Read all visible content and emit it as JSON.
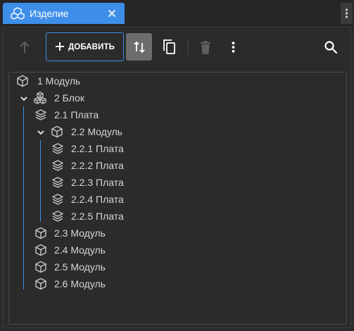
{
  "tab": {
    "title": "Изделие",
    "icon": "cubes-outline-icon"
  },
  "toolbar": {
    "add_label": "ДОБАВИТЬ"
  },
  "tree": [
    {
      "label": "1 Модуль",
      "icon": "cube-icon"
    },
    {
      "label": "2 Блок",
      "icon": "block-stack-icon",
      "expanded": true
    },
    {
      "label": "2.1 Плата",
      "icon": "layers-icon"
    },
    {
      "label": "2.2 Модуль",
      "icon": "cube-icon",
      "expanded": true
    },
    {
      "label": "2.2.1 Плата",
      "icon": "layers-icon"
    },
    {
      "label": "2.2.2 Плата",
      "icon": "layers-icon"
    },
    {
      "label": "2.2.3 Плата",
      "icon": "layers-icon"
    },
    {
      "label": "2.2.4 Плата",
      "icon": "layers-icon"
    },
    {
      "label": "2.2.5 Плата",
      "icon": "layers-icon"
    },
    {
      "label": "2.3 Модуль",
      "icon": "cube-icon"
    },
    {
      "label": "2.4 Модуль",
      "icon": "cube-icon"
    },
    {
      "label": "2.5 Модуль",
      "icon": "cube-icon"
    },
    {
      "label": "2.6 Модуль",
      "icon": "cube-icon"
    }
  ],
  "colors": {
    "accent": "#3d8ee8",
    "background": "#2b2b2b",
    "text": "#d6d6d6"
  }
}
